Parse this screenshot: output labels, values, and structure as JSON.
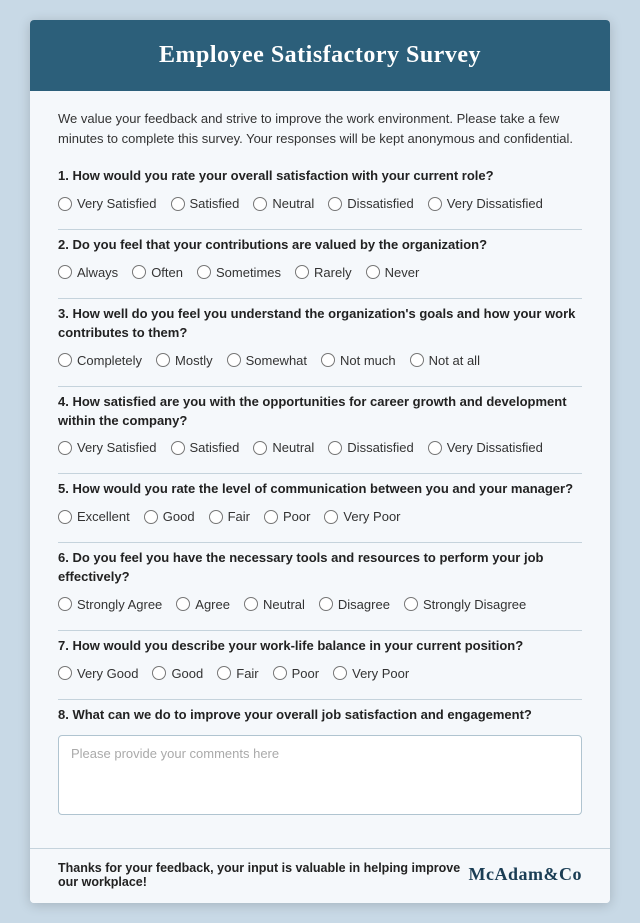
{
  "header": {
    "title": "Employee Satisfactory Survey"
  },
  "intro": "We value your feedback and strive to improve the work environment. Please take a few minutes to complete this survey. Your responses will be kept anonymous and confidential.",
  "questions": [
    {
      "id": "q1",
      "number": "1",
      "text": "How would you rate your overall satisfaction with your current role?",
      "options": [
        "Very Satisfied",
        "Satisfied",
        "Neutral",
        "Dissatisfied",
        "Very Dissatisfied"
      ]
    },
    {
      "id": "q2",
      "number": "2",
      "text": "Do you feel that your contributions are valued by the organization?",
      "options": [
        "Always",
        "Often",
        "Sometimes",
        "Rarely",
        "Never"
      ]
    },
    {
      "id": "q3",
      "number": "3",
      "text": "How well do you feel you understand the organization's goals and how your work contributes to them?",
      "options": [
        "Completely",
        "Mostly",
        "Somewhat",
        "Not much",
        "Not at all"
      ]
    },
    {
      "id": "q4",
      "number": "4",
      "text": "How satisfied are you with the opportunities for career growth and development within the company?",
      "options": [
        "Very Satisfied",
        "Satisfied",
        "Neutral",
        "Dissatisfied",
        "Very Dissatisfied"
      ]
    },
    {
      "id": "q5",
      "number": "5",
      "text": "How would you rate the level of communication between you and your manager?",
      "options": [
        "Excellent",
        "Good",
        "Fair",
        "Poor",
        "Very Poor"
      ]
    },
    {
      "id": "q6",
      "number": "6",
      "text": "Do you feel you have the necessary tools and resources to perform your job effectively?",
      "options": [
        "Strongly Agree",
        "Agree",
        "Neutral",
        "Disagree",
        "Strongly Disagree"
      ]
    },
    {
      "id": "q7",
      "number": "7",
      "text": "How would you describe your work-life balance in your current position?",
      "options": [
        "Very Good",
        "Good",
        "Fair",
        "Poor",
        "Very Poor"
      ]
    },
    {
      "id": "q8",
      "number": "8",
      "text": "What can we do to improve your overall job satisfaction and engagement?",
      "placeholder": "Please provide your comments here"
    }
  ],
  "footer": {
    "text": "Thanks for your feedback, your input is valuable in helping improve our workplace!",
    "brand": "McAdam&Co"
  }
}
